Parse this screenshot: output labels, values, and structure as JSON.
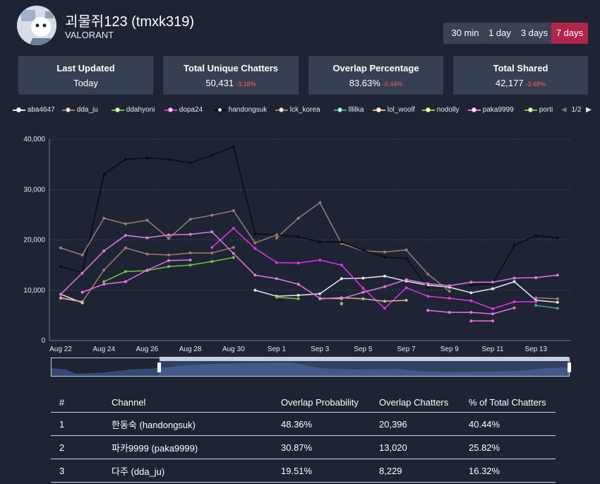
{
  "header": {
    "title": "괴물쥐123 (tmxk319)",
    "game": "VALORANT"
  },
  "ranges": [
    {
      "label": "30 min",
      "active": false
    },
    {
      "label": "1 day",
      "active": false
    },
    {
      "label": "3 days",
      "active": false
    },
    {
      "label": "7 days",
      "active": true
    }
  ],
  "cards": [
    {
      "title": "Last Updated",
      "value": "Today",
      "delta": ""
    },
    {
      "title": "Total Unique Chatters",
      "value": "50,431",
      "delta": "-3.18%"
    },
    {
      "title": "Overlap Percentage",
      "value": "83.63%",
      "delta": "-0.44%"
    },
    {
      "title": "Total Shared",
      "value": "42,177",
      "delta": "-3.68%"
    }
  ],
  "legend_pager": "1/2",
  "table": {
    "headers": [
      "#",
      "Channel",
      "Overlap Probability",
      "Overlap Chatters",
      "% of Total Chatters"
    ],
    "rows": [
      [
        "1",
        "한동숙 (handongsuk)",
        "48.36%",
        "20,396",
        "40.44%"
      ],
      [
        "2",
        "파카9999 (paka9999)",
        "30.87%",
        "13,020",
        "25.82%"
      ],
      [
        "3",
        "다주 (dda_ju)",
        "19.51%",
        "8,229",
        "16.32%"
      ]
    ]
  },
  "chart_data": {
    "type": "line",
    "x": [
      "Aug 22",
      "Aug 23",
      "Aug 24",
      "Aug 25",
      "Aug 26",
      "Aug 27",
      "Aug 28",
      "Aug 29",
      "Aug 30",
      "Aug 31",
      "Sep 1",
      "Sep 2",
      "Sep 3",
      "Sep 4",
      "Sep 5",
      "Sep 6",
      "Sep 7",
      "Sep 8",
      "Sep 9",
      "Sep 10",
      "Sep 11",
      "Sep 12",
      "Sep 13",
      "Sep 14"
    ],
    "x_tick_labels": [
      "Aug 22",
      "Aug 24",
      "Aug 26",
      "Aug 28",
      "Aug 30",
      "Sep 1",
      "Sep 3",
      "Sep 5",
      "Sep 7",
      "Sep 9",
      "Sep 11",
      "Sep 13"
    ],
    "y_tick_labels": [
      "0",
      "10,000",
      "20,000",
      "30,000",
      "40,000"
    ],
    "ylim": [
      0,
      40000
    ],
    "legend_position": "top",
    "series": [
      {
        "name": "aba4647",
        "color": "#e8e4f2",
        "values": [
          9200,
          7500,
          null,
          null,
          null,
          null,
          null,
          null,
          null,
          10000,
          8800,
          9000,
          9300,
          12300,
          12400,
          12800,
          11800,
          11000,
          10600,
          9500,
          10300,
          11700,
          8000,
          7600
        ]
      },
      {
        "name": "dda_ju",
        "color": "#9c7d78",
        "values": [
          8400,
          7700,
          14000,
          18400,
          17200,
          17000,
          17400,
          17400,
          18500,
          null,
          20400,
          24300,
          27400,
          19300,
          17800,
          17600,
          18000,
          13200,
          9800,
          null,
          null,
          null,
          8500,
          8300
        ]
      },
      {
        "name": "ddahyoni",
        "color": "#73c442",
        "values": [
          null,
          null,
          11700,
          13700,
          13900,
          14700,
          15000,
          15700,
          16500,
          null,
          8600,
          8300,
          null,
          7400,
          null,
          null,
          null,
          null,
          null,
          null,
          null,
          null,
          null,
          null
        ]
      },
      {
        "name": "dopa24",
        "color": "#e533e5",
        "values": [
          null,
          null,
          null,
          null,
          null,
          null,
          null,
          18500,
          22300,
          18300,
          15500,
          15400,
          16000,
          15000,
          10400,
          6400,
          10500,
          8800,
          8400,
          7900,
          6300,
          7700,
          7700,
          null
        ]
      },
      {
        "name": "handongsuk",
        "color": "#0a0a14",
        "values": [
          14700,
          13500,
          33000,
          36000,
          36300,
          36000,
          35300,
          36800,
          38500,
          21200,
          21000,
          20600,
          19600,
          19600,
          17900,
          16600,
          16300,
          10500,
          null,
          11000,
          11300,
          18900,
          20800,
          20400
        ]
      },
      {
        "name": "lck_korea",
        "color": "#9c7d78",
        "values": [
          18400,
          17000,
          24300,
          23200,
          23900,
          20300,
          24100,
          24900,
          25800,
          19400,
          21000,
          null,
          null,
          null,
          null,
          null,
          null,
          null,
          null,
          null,
          null,
          null,
          null,
          null
        ]
      },
      {
        "name": "lllilka",
        "color": "#3aa88a",
        "values": [
          null,
          null,
          null,
          null,
          null,
          null,
          null,
          null,
          null,
          null,
          null,
          null,
          null,
          null,
          null,
          null,
          null,
          null,
          null,
          null,
          null,
          null,
          7000,
          6400
        ]
      },
      {
        "name": "lol_woolf",
        "color": "#e0b48c",
        "values": [
          8500,
          7700,
          null,
          null,
          null,
          null,
          null,
          null,
          null,
          null,
          null,
          null,
          8300,
          8500,
          8300,
          7800,
          8000,
          null,
          null,
          null,
          null,
          null,
          null,
          null
        ]
      },
      {
        "name": "nodolly",
        "color": "#9ad23c",
        "values": [
          null,
          null,
          null,
          null,
          null,
          null,
          null,
          null,
          null,
          null,
          null,
          null,
          null,
          7300,
          null,
          null,
          null,
          null,
          null,
          null,
          null,
          null,
          null,
          null
        ]
      },
      {
        "name": "paka9999",
        "color": "#e07ae0",
        "values": [
          9200,
          13400,
          17800,
          20900,
          20400,
          21000,
          21100,
          21600,
          17300,
          13000,
          12300,
          11200,
          8400,
          8300,
          9600,
          10700,
          12100,
          11300,
          10900,
          11600,
          11600,
          12400,
          12500,
          13000
        ]
      },
      {
        "name": "porti",
        "color": "#73c442",
        "values": [
          null,
          null,
          null,
          null,
          null,
          null,
          null,
          null,
          null,
          null,
          null,
          null,
          null,
          null,
          null,
          null,
          null,
          null,
          null,
          null,
          null,
          null,
          null,
          null
        ]
      },
      {
        "name": "",
        "color": "#ec6fec",
        "values": [
          null,
          9600,
          11200,
          11700,
          14000,
          15900,
          16000,
          null,
          null,
          null,
          null,
          null,
          null,
          null,
          null,
          null,
          null,
          6000,
          5600,
          5600,
          5300,
          6500,
          null,
          null
        ]
      },
      {
        "name": "",
        "color": "#ec6fec",
        "values": [
          null,
          null,
          null,
          null,
          null,
          null,
          null,
          null,
          null,
          null,
          null,
          null,
          null,
          null,
          null,
          null,
          null,
          null,
          null,
          3900,
          3900,
          null,
          null,
          null
        ]
      }
    ]
  }
}
